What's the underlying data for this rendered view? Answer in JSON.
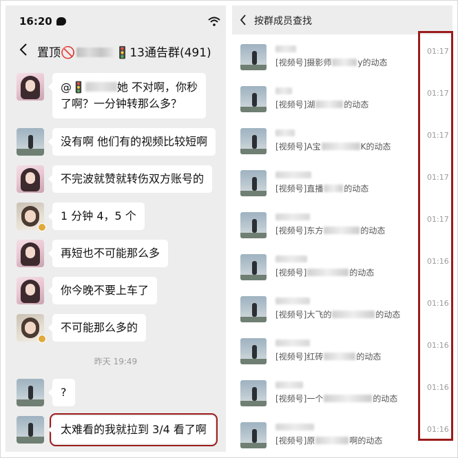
{
  "left": {
    "status_time": "16:20",
    "title_prefix": "置顶🚫",
    "title_suffix": "🚦13通告群(491)",
    "messages": [
      {
        "avatar": "girl",
        "text_before": "@🚦",
        "text_after": "她  不对啊，你秒",
        "line2": "了啊？一分钟转那么多？"
      },
      {
        "avatar": "man",
        "text": "没有啊 他们有的视频比较短啊"
      },
      {
        "avatar": "girl",
        "text": "不完波就赞就转伤双方账号的"
      },
      {
        "avatar": "woman",
        "text": "1 分钟 4，5 个"
      },
      {
        "avatar": "girl",
        "text": "再短也不可能那么多"
      },
      {
        "avatar": "girl",
        "text": "你今晚不要上车了"
      },
      {
        "avatar": "woman",
        "text": "不可能那么多的"
      },
      {
        "avatar": "man",
        "text": "?"
      },
      {
        "avatar": "man",
        "text": "太难看的我就拉到 3/4 看了啊"
      }
    ],
    "timestamp": "昨天 19:49"
  },
  "right": {
    "title": "按群成员查找",
    "rows": [
      {
        "prefix": "[视频号]摄影师",
        "suffix": "y的动态",
        "time": "01:17"
      },
      {
        "prefix": "[视频号]湖",
        "suffix": "的动态",
        "time": "01:17"
      },
      {
        "prefix": "[视频号]A宝",
        "suffix": "K的动态",
        "time": "01:17"
      },
      {
        "prefix": "[视频号]直播",
        "suffix": "的动态",
        "time": "01:17"
      },
      {
        "prefix": "[视频号]东方",
        "suffix": "的动态",
        "time": "01:17"
      },
      {
        "prefix": "[视频号]",
        "suffix": "的动态",
        "time": "01:16"
      },
      {
        "prefix": "[视频号]大飞的",
        "suffix": "的动态",
        "time": "01:16"
      },
      {
        "prefix": "[视频号]红砖",
        "suffix": "的动态",
        "time": "01:16"
      },
      {
        "prefix": "[视频号]一个",
        "suffix": "的动态",
        "time": "01:16"
      },
      {
        "prefix": "[视频号]原",
        "suffix": "啊的动态",
        "time": "01:16"
      }
    ]
  },
  "colors": {
    "chat_background": "#ededed",
    "bubble": "#ffffff",
    "highlight_border": "#9b1b1b",
    "timestamp_text": "#9a9a9a"
  },
  "icons": [
    "back-arrow-icon",
    "wifi-icon",
    "message-status-icon",
    "verified-badge-icon"
  ]
}
